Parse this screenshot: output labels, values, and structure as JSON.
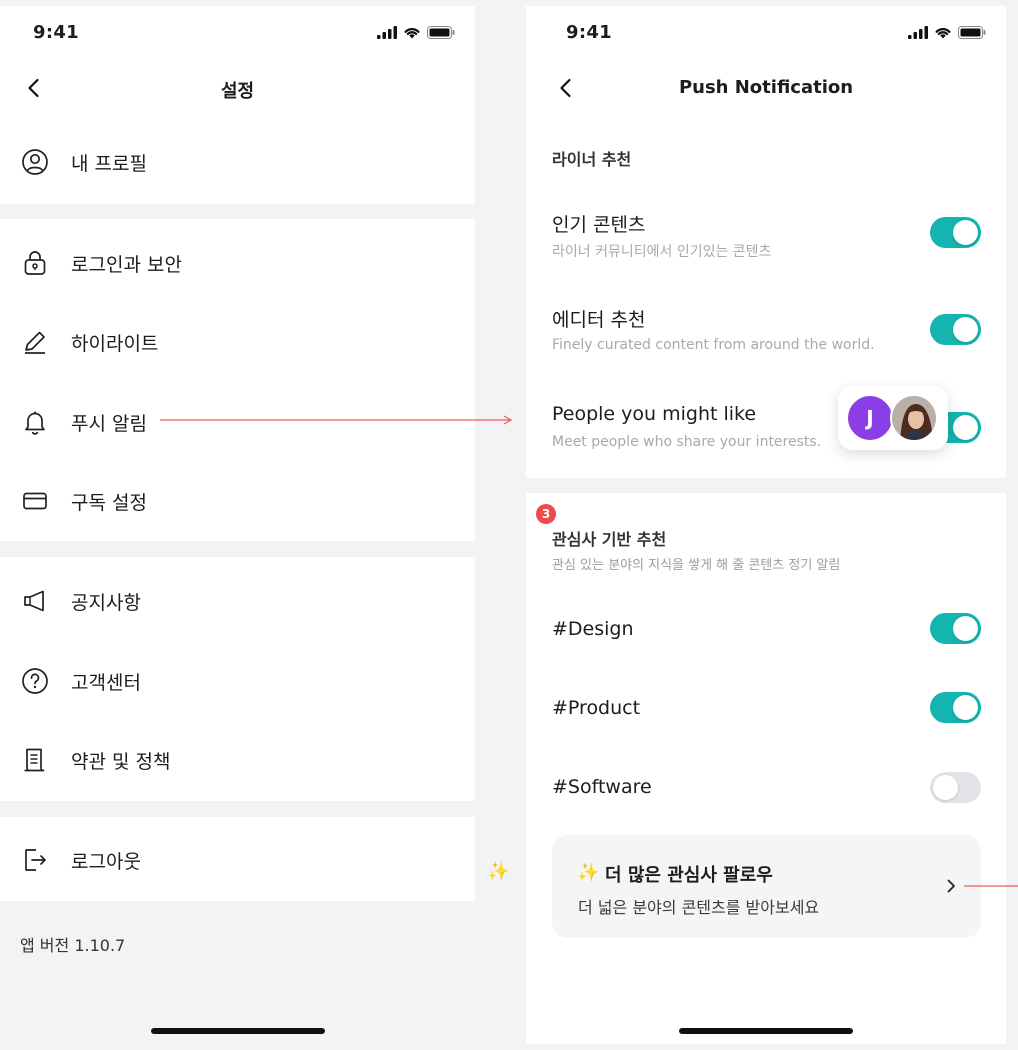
{
  "status_bar": {
    "time": "9:41"
  },
  "left": {
    "title": "설정",
    "groups": [
      {
        "items": [
          {
            "label": "내 프로필",
            "icon": "user-circle-icon"
          }
        ]
      },
      {
        "items": [
          {
            "label": "로그인과 보안",
            "icon": "lock-icon"
          },
          {
            "label": "하이라이트",
            "icon": "pen-icon"
          },
          {
            "label": "푸시 알림",
            "icon": "bell-icon"
          },
          {
            "label": "구독 설정",
            "icon": "credit-card-icon"
          }
        ]
      },
      {
        "items": [
          {
            "label": "공지사항",
            "icon": "megaphone-icon"
          },
          {
            "label": "고객센터",
            "icon": "question-circle-icon"
          },
          {
            "label": "약관 및 정책",
            "icon": "document-icon"
          }
        ]
      },
      {
        "items": [
          {
            "label": "로그아웃",
            "icon": "logout-icon"
          }
        ]
      }
    ],
    "version": "앱 버전 1.10.7"
  },
  "right": {
    "title": "Push Notification",
    "section1": {
      "title": "라이너 추천",
      "items": [
        {
          "title": "인기 콘텐츠",
          "subtitle": "라이너 커뮤니티에서 인기있는 콘텐츠",
          "enabled": true
        },
        {
          "title": "에디터 추천",
          "subtitle": "Finely curated content from around the world.",
          "enabled": true
        },
        {
          "title": "People you might like",
          "subtitle": "Meet people who share your interests.",
          "enabled": true
        }
      ],
      "avatar_initial": "J"
    },
    "section2": {
      "badge": "3",
      "title": "관심사 기반 추천",
      "subtitle": "관심 있는 분야의 지식을 쌓게 해 줄 콘텐츠 정기 알림",
      "items": [
        {
          "title": "#Design",
          "enabled": true
        },
        {
          "title": "#Product",
          "enabled": true
        },
        {
          "title": "#Software",
          "enabled": false
        }
      ]
    },
    "more_card": {
      "sparkle": "✨",
      "title": "더 많은 관심사 팔로우",
      "subtitle": "더 넓은 분야의 콘텐츠를 받아보세요"
    }
  },
  "gap_sparkle": "✨",
  "colors": {
    "accent": "#14b5b0",
    "toggle_off": "#e2e4e8",
    "badge": "#ef4a4a",
    "avatar": "#8c3ee6",
    "connector": "#ee5a5a"
  }
}
